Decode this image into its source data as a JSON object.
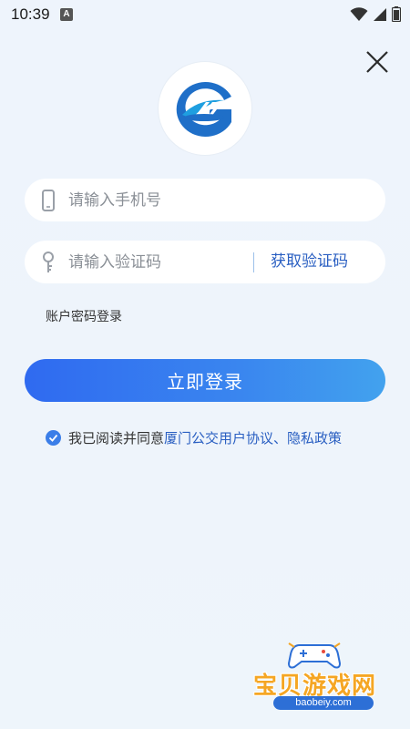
{
  "status_bar": {
    "time": "10:39",
    "notification_letter": "A"
  },
  "login_form": {
    "phone_placeholder": "请输入手机号",
    "code_placeholder": "请输入验证码",
    "get_code_label": "获取验证码",
    "password_login_label": "账户密码登录",
    "submit_label": "立即登录"
  },
  "agreement": {
    "prefix": "我已阅读并同意",
    "terms_link": "厦门公交用户协议",
    "separator": "、",
    "privacy_link": "隐私政策",
    "checked": true
  },
  "watermark": {
    "title": "宝贝游戏网",
    "url": "baobeiy.com"
  },
  "colors": {
    "accent": "#2a5fc2",
    "button_start": "#2f6af0",
    "button_end": "#42a2ee",
    "background": "#eef4fc",
    "logo_blue": "#1f6fc8"
  },
  "icons": [
    "wifi-icon",
    "signal-icon",
    "battery-icon",
    "close-icon",
    "xiamen-bus-logo",
    "phone-icon",
    "key-icon",
    "check-icon",
    "gamepad-icon"
  ]
}
